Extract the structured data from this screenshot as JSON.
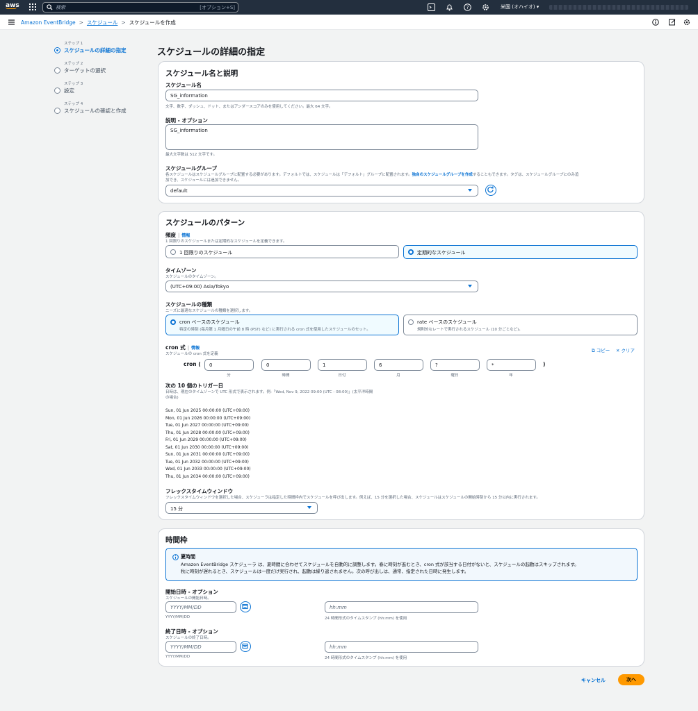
{
  "topnav": {
    "logo": "aws",
    "search_placeholder": "検索",
    "search_shortcut": "[オプション+S]",
    "region": "米国 (オハイオ) ▾",
    "icons": [
      "grid-icon",
      "search-icon",
      "terminal-icon",
      "bell-icon",
      "help-icon",
      "gear-icon"
    ]
  },
  "breadcrumb": {
    "items": [
      "Amazon EventBridge",
      "スケジュール",
      "スケジュールを作成"
    ],
    "right_icons": [
      "info-circle-icon",
      "feedback-icon",
      "settings-icon"
    ]
  },
  "steps": [
    {
      "num": "ステップ 1",
      "label": "スケジュールの詳細の指定"
    },
    {
      "num": "ステップ 2",
      "label": "ターゲットの選択"
    },
    {
      "num": "ステップ 3",
      "label": "設定"
    },
    {
      "num": "ステップ 4",
      "label": "スケジュールの確認と作成"
    }
  ],
  "page_title": "スケジュールの詳細の指定",
  "name_panel": {
    "title": "スケジュール名と説明",
    "name_label": "スケジュール名",
    "name_value": "SG_information",
    "name_hint": "文字、数字、ダッシュ、ドット、またはアンダースコアのみを使用してください。最大 64 文字。",
    "desc_label": "説明 - オプション",
    "desc_value": "SG_information",
    "desc_hint": "最大文字数は 512 文字です。",
    "group_label": "スケジュールグループ",
    "group_desc_1": "各スケジュールはスケジュールグループに配置する必要があります。デフォルトでは、スケジュールは「デフォルト」グループに配置されます。",
    "group_desc_link": "独自のスケジュールグループを作成",
    "group_desc_2": "することもできます。タグは、スケジュールグループにのみ追",
    "group_desc_3": "加でき、スケジュールには追加できません。",
    "group_value": "default"
  },
  "pattern_panel": {
    "title": "スケジュールのパターン",
    "freq_label": "頻度",
    "info": "情報",
    "freq_desc": "1 回限りのスケジュールまたは定期的なスケジュールを定義できます。",
    "freq_options": [
      "1 回限りのスケジュール",
      "定期的なスケジュール"
    ],
    "freq_selected": 1,
    "tz_label": "タイムゾーン",
    "tz_desc": "スケジュールのタイムゾーン。",
    "tz_value": "(UTC+09:00) Asia/Tokyo",
    "type_label": "スケジュールの種類",
    "type_desc": "ニーズに最適なスケジュールの種類を選択します。",
    "type_options": [
      {
        "title": "cron ベースのスケジュール",
        "sub": "特定の時刻 (毎月第 1 月曜日の午前 8 時 (PST) など) に実行される cron 式を使用したスケジュールのセット。"
      },
      {
        "title": "rate ベースのスケジュール",
        "sub": "規則的なレートで実行されるスケジュール (10 分ごとなど)。"
      }
    ],
    "type_selected": 0,
    "cron_label": "cron 式",
    "cron_desc": "スケジュールの cron 式を定義",
    "copy": "コピー",
    "clear": "クリア",
    "cron_prefix": "cron (",
    "cron_suffix": ")",
    "cron_fields": [
      {
        "value": "0",
        "label": "分"
      },
      {
        "value": "0",
        "label": "時間"
      },
      {
        "value": "1",
        "label": "日付"
      },
      {
        "value": "6",
        "label": "月"
      },
      {
        "value": "?",
        "label": "曜日"
      },
      {
        "value": "*",
        "label": "年"
      }
    ],
    "next_label": "次の 10 個のトリガー日",
    "next_desc_1": "日時は、現在のタイムゾーンで UTC 形式で表示されます。例:「Wed, Nov 9, 2022 09:00 (UTC - 08:00)」(太平洋時間",
    "next_desc_2": "の場合)",
    "triggers": [
      "Sun, 01 Jun 2025 00:00:00 (UTC+09:00)",
      "Mon, 01 Jun 2026 00:00:00 (UTC+09:00)",
      "Tue, 01 Jun 2027 00:00:00 (UTC+09:00)",
      "Thu, 01 Jun 2028 00:00:00 (UTC+09:00)",
      "Fri, 01 Jun 2029 00:00:00 (UTC+09:00)",
      "Sat, 01 Jun 2030 00:00:00 (UTC+09:00)",
      "Sun, 01 Jun 2031 00:00:00 (UTC+09:00)",
      "Tue, 01 Jun 2032 00:00:00 (UTC+09:00)",
      "Wed, 01 Jun 2033 00:00:00 (UTC+09:00)",
      "Thu, 01 Jun 2034 00:00:00 (UTC+09:00)"
    ],
    "flex_label": "フレックスタイムウィンドウ",
    "flex_desc": "フレックスタイムウィンドウを選択した場合、スケジューラは指定した時間枠内でスケジュールを呼び出します。例えば、15 分を選択した場合、スケジュールはスケジュールの開始時刻から 15 分以内に実行されます。",
    "flex_value": "15 分"
  },
  "time_panel": {
    "title": "時間枠",
    "alert_title": "夏時間",
    "alert_line1": "Amazon EventBridge スケジューラ は、夏時間に合わせてスケジュールを自動的に調整します。春に時刻が進むとき、cron 式が該当する日付がないと、スケジュールの起動はスキップされます。",
    "alert_line2": "秋に時刻が遅れるとき、スケジュールは一度だけ実行され、起動は繰り返されません。次の呼び出しは、通常、指定された日時に発生します。",
    "start_label": "開始日時 - オプション",
    "start_desc": "スケジュールの開始日時。",
    "end_label": "終了日時 - オプション",
    "end_desc": "スケジュールの終了日時。",
    "date_placeholder": "YYYY/MM/DD",
    "date_hint": "YYYY/MM/DD",
    "time_placeholder": "hh:mm",
    "time_hint": "24 時間形式のタイムスタンプ (hh:mm) を使用"
  },
  "footer": {
    "cancel": "キャンセル",
    "next": "次へ"
  },
  "colors": {
    "accent": "#0972d3",
    "primary_button": "#ff9900",
    "nav_bg": "#232f3e"
  }
}
